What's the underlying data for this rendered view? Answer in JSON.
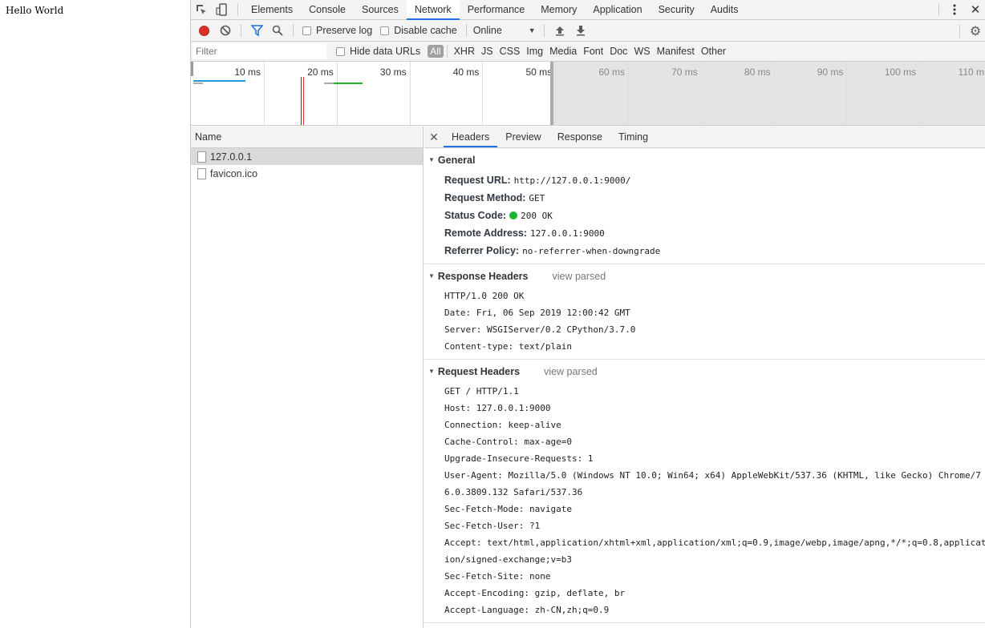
{
  "page": {
    "text": "Hello World"
  },
  "devtools": {
    "panel_tabs": [
      "Elements",
      "Console",
      "Sources",
      "Network",
      "Performance",
      "Memory",
      "Application",
      "Security",
      "Audits"
    ],
    "active_tab": "Network",
    "toolbar": {
      "preserve_log": "Preserve log",
      "disable_cache": "Disable cache",
      "throttle": "Online"
    },
    "filter": {
      "placeholder": "Filter",
      "hide_data_urls": "Hide data URLs",
      "types": [
        "All",
        "XHR",
        "JS",
        "CSS",
        "Img",
        "Media",
        "Font",
        "Doc",
        "WS",
        "Manifest",
        "Other"
      ]
    },
    "overview": {
      "labels": [
        "10 ms",
        "20 ms",
        "30 ms",
        "40 ms",
        "50 ms",
        "60 ms",
        "70 ms",
        "80 ms",
        "90 ms",
        "100 ms",
        "110 ms"
      ]
    },
    "request_list": {
      "header": "Name",
      "items": [
        "127.0.0.1",
        "favicon.ico"
      ]
    },
    "detail_tabs": [
      "Headers",
      "Preview",
      "Response",
      "Timing"
    ],
    "general": {
      "title": "General",
      "rows": [
        {
          "k": "Request URL:",
          "v": "http://127.0.0.1:9000/"
        },
        {
          "k": "Request Method:",
          "v": "GET"
        },
        {
          "k": "Status Code:",
          "v": "200 OK"
        },
        {
          "k": "Remote Address:",
          "v": "127.0.0.1:9000"
        },
        {
          "k": "Referrer Policy:",
          "v": "no-referrer-when-downgrade"
        }
      ]
    },
    "response_headers": {
      "title": "Response Headers",
      "view_parsed": "view parsed",
      "lines": [
        "HTTP/1.0 200 OK",
        "Date: Fri, 06 Sep 2019 12:00:42 GMT",
        "Server: WSGIServer/0.2 CPython/3.7.0",
        "Content-type: text/plain"
      ]
    },
    "request_headers": {
      "title": "Request Headers",
      "view_parsed": "view parsed",
      "lines": [
        "GET / HTTP/1.1",
        "Host: 127.0.0.1:9000",
        "Connection: keep-alive",
        "Cache-Control: max-age=0",
        "Upgrade-Insecure-Requests: 1",
        "User-Agent: Mozilla/5.0 (Windows NT 10.0; Win64; x64) AppleWebKit/537.36 (KHTML, like Gecko) Chrome/7",
        "6.0.3809.132 Safari/537.36",
        "Sec-Fetch-Mode: navigate",
        "Sec-Fetch-User: ?1",
        "Accept: text/html,application/xhtml+xml,application/xml;q=0.9,image/webp,image/apng,*/*;q=0.8,applicat",
        "ion/signed-exchange;v=b3",
        "Sec-Fetch-Site: none",
        "Accept-Encoding: gzip, deflate, br",
        "Accept-Language: zh-CN,zh;q=0.9"
      ]
    }
  }
}
